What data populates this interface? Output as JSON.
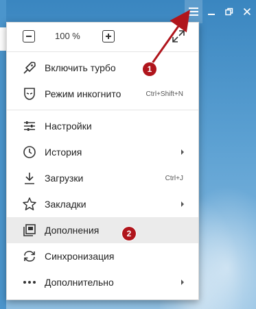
{
  "colors": {
    "accent": "#b0151c",
    "background": "#3a86c0"
  },
  "window": {
    "buttons": [
      {
        "name": "menu",
        "icon": "hamburger-icon"
      },
      {
        "name": "minimize",
        "icon": "minimize-icon"
      },
      {
        "name": "restore",
        "icon": "restore-icon"
      },
      {
        "name": "close",
        "icon": "close-icon"
      }
    ]
  },
  "zoom": {
    "value": "100 %",
    "minus_icon": "minus-icon",
    "plus_icon": "plus-icon",
    "fullscreen_icon": "fullscreen-icon"
  },
  "menu": {
    "section1": [
      {
        "label": "Включить турбо",
        "icon": "rocket-icon"
      },
      {
        "label": "Режим инкогнито",
        "icon": "mask-icon",
        "shortcut": "Ctrl+Shift+N"
      }
    ],
    "section2": [
      {
        "label": "Настройки",
        "icon": "sliders-icon"
      },
      {
        "label": "История",
        "icon": "clock-icon",
        "submenu": true
      },
      {
        "label": "Загрузки",
        "icon": "download-icon",
        "shortcut": "Ctrl+J"
      },
      {
        "label": "Закладки",
        "icon": "star-icon",
        "submenu": true
      },
      {
        "label": "Дополнения",
        "icon": "extensions-icon",
        "highlighted": true
      },
      {
        "label": "Синхронизация",
        "icon": "sync-icon"
      },
      {
        "label": "Дополнительно",
        "icon": "more-icon",
        "submenu": true
      }
    ]
  },
  "annotations": {
    "badge1": "1",
    "badge2": "2"
  }
}
